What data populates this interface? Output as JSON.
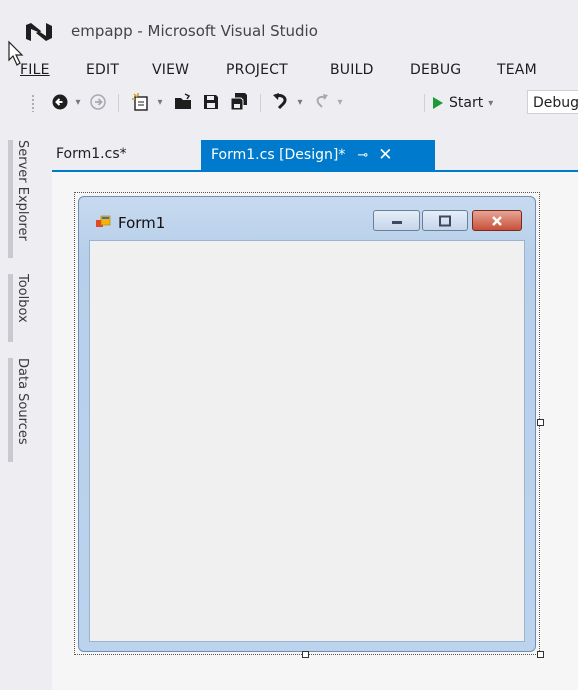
{
  "window": {
    "title": "empapp - Microsoft Visual Studio"
  },
  "menu": {
    "items": [
      {
        "label": "FILE",
        "mnemonic": "F"
      },
      {
        "label": "EDIT",
        "mnemonic": "E"
      },
      {
        "label": "VIEW",
        "mnemonic": "V"
      },
      {
        "label": "PROJECT",
        "mnemonic": "P"
      },
      {
        "label": "BUILD",
        "mnemonic": "B"
      },
      {
        "label": "DEBUG",
        "mnemonic": "D"
      },
      {
        "label": "TEAM",
        "mnemonic": "M"
      }
    ]
  },
  "toolbar": {
    "start_label": "Start",
    "config_value": "Debug",
    "icons": [
      "back-icon",
      "forward-icon",
      "new-project-icon",
      "open-file-icon",
      "save-icon",
      "save-all-icon",
      "undo-icon",
      "redo-icon",
      "start-icon"
    ]
  },
  "side_panels": [
    "Server Explorer",
    "Toolbox",
    "Data Sources"
  ],
  "tabs": [
    {
      "label": "Form1.cs*",
      "active": false
    },
    {
      "label": "Form1.cs [Design]*",
      "active": true
    }
  ],
  "form": {
    "title": "Form1"
  },
  "colors": {
    "accent": "#007acc",
    "background": "#eeeef2",
    "form_frame": "#b9d1ea",
    "close_button": "#c8503a"
  }
}
